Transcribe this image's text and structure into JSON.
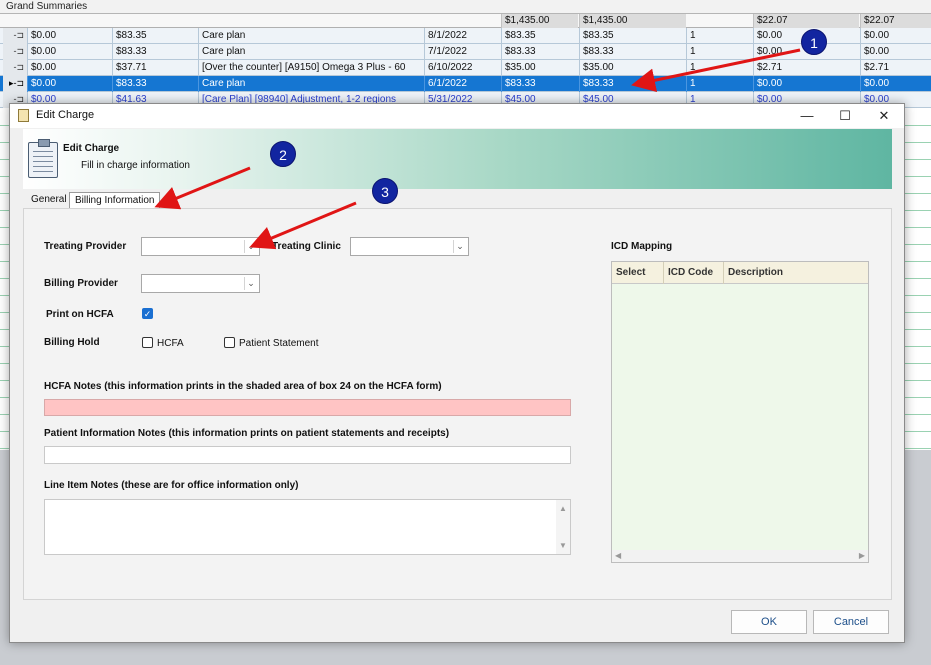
{
  "background_grid": {
    "title": "Grand Summaries",
    "summary_values": [
      "$1,435.00",
      "$1,435.00",
      "$22.07",
      "$22.07"
    ],
    "rows": [
      {
        "c1": "$0.00",
        "c2": "$83.35",
        "desc": "Care plan",
        "date": "8/1/2022",
        "a": "$83.35",
        "b": "$83.35",
        "qty": "1",
        "c": "$0.00",
        "d": "$0.00"
      },
      {
        "c1": "$0.00",
        "c2": "$83.33",
        "desc": "Care plan",
        "date": "7/1/2022",
        "a": "$83.33",
        "b": "$83.33",
        "qty": "1",
        "c": "$0.00",
        "d": "$0.00"
      },
      {
        "c1": "$0.00",
        "c2": "$37.71",
        "desc": "[Over the counter] [A9150] Omega 3 Plus - 60",
        "date": "6/10/2022",
        "a": "$35.00",
        "b": "$35.00",
        "qty": "1",
        "c": "$2.71",
        "d": "$2.71"
      },
      {
        "c1": "$0.00",
        "c2": "$83.33",
        "desc": "Care plan",
        "date": "6/1/2022",
        "a": "$83.33",
        "b": "$83.33",
        "qty": "1",
        "c": "$0.00",
        "d": "$0.00"
      },
      {
        "c1": "$0.00",
        "c2": "$41.63",
        "desc": "[Care Plan] [98940] Adjustment, 1-2 regions",
        "date": "5/31/2022",
        "a": "$45.00",
        "b": "$45.00",
        "qty": "1",
        "c": "$0.00",
        "d": "$0.00"
      }
    ]
  },
  "dialog": {
    "title": "Edit Charge",
    "header_title": "Edit Charge",
    "header_subtitle": "Fill in charge information",
    "tabs": [
      "General",
      "Billing Information"
    ],
    "treating_provider_label": "Treating Provider",
    "treating_clinic_label": "Treating Clinic",
    "billing_provider_label": "Billing Provider",
    "print_on_hcfa_label": "Print on HCFA",
    "billing_hold_label": "Billing Hold",
    "hcfa_checkbox_label": "HCFA",
    "patient_statement_label": "Patient Statement",
    "hcfa_notes_label": "HCFA Notes (this information prints in the shaded area of box 24 on the HCFA form)",
    "patient_notes_label": "Patient Information Notes (this information prints on patient statements and receipts)",
    "line_item_notes_label": "Line Item Notes (these are for office information only)",
    "icd_mapping_label": "ICD Mapping",
    "icd_columns": [
      "Select",
      "ICD Code",
      "Description"
    ],
    "ok_label": "OK",
    "cancel_label": "Cancel",
    "print_on_hcfa_checked": true,
    "hcfa_checked": false,
    "patient_statement_checked": false
  },
  "annotations": [
    "1",
    "2",
    "3"
  ],
  "colors": {
    "selected_row": "#1576d2",
    "badge": "#1225a0",
    "arrow": "#e01515",
    "hcfa_notes_fill": "#ffc4c4",
    "checkbox_on": "#1a6fd1"
  }
}
